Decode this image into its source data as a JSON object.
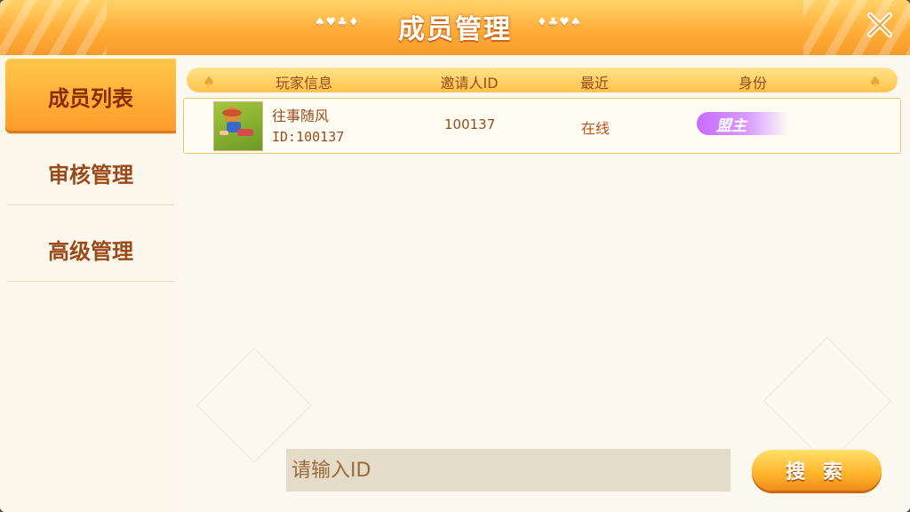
{
  "header": {
    "title": "成员管理",
    "left_suits": "♠♥♣♦",
    "right_suits": "♦♣♥♠"
  },
  "sidebar": {
    "items": [
      {
        "label": "成员列表",
        "active": true
      },
      {
        "label": "审核管理",
        "active": false
      },
      {
        "label": "高级管理",
        "active": false
      }
    ]
  },
  "table": {
    "columns": [
      "玩家信息",
      "邀请人ID",
      "最近",
      "身份"
    ],
    "rows": [
      {
        "name": "往事随风",
        "id": "ID:100137",
        "inviter_id": "100137",
        "status": "在线",
        "role": "盟主"
      }
    ]
  },
  "search": {
    "placeholder": "请输入ID",
    "button_label": "搜 索"
  },
  "colors": {
    "header": "#ffae3a",
    "accent_text": "#9a4a1a",
    "badge": "#c86bff",
    "status_online": "#c0501a"
  }
}
